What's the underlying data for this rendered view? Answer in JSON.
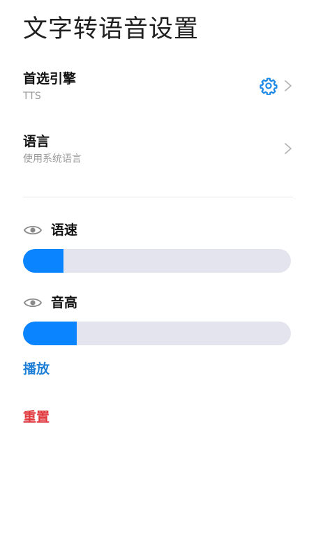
{
  "page": {
    "title": "文字转语音设置"
  },
  "engine": {
    "title": "首选引擎",
    "value": "TTS",
    "icon": "gear-icon"
  },
  "language": {
    "title": "语言",
    "value": "使用系统语言"
  },
  "sliders": {
    "speed": {
      "label": "语速",
      "level": 0.15
    },
    "pitch": {
      "label": "音高",
      "level": 0.2
    }
  },
  "actions": {
    "play": "播放",
    "reset": "重置"
  },
  "colors": {
    "accent": "#0a84ff",
    "track": "#e4e4ee",
    "play": "#1e7fd6",
    "reset": "#e0393e"
  }
}
